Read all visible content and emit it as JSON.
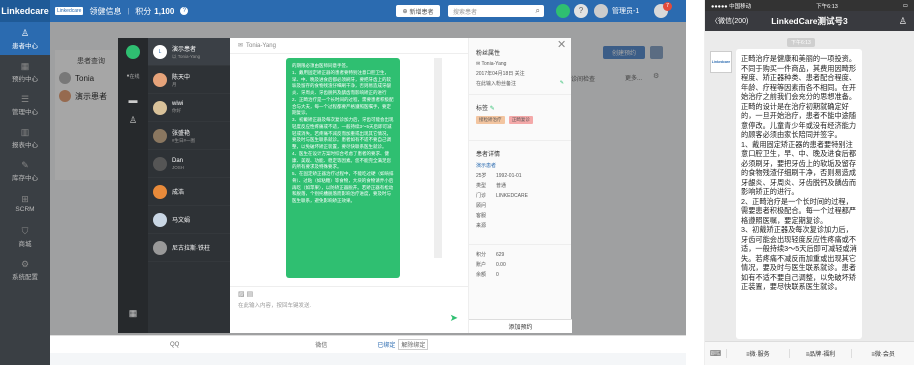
{
  "topbar": {
    "logo": "Linkedcare",
    "mini_logo": "Linkedcare",
    "title": "领健信息",
    "points_label": "积分",
    "points_value": "1,100",
    "new_patient_btn": "新增患者",
    "search_placeholder": "搜索患者",
    "user": "管理员-1",
    "badge": "7"
  },
  "sidebar": {
    "items": [
      {
        "label": "患者中心"
      },
      {
        "label": "预约中心"
      },
      {
        "label": "管理中心"
      },
      {
        "label": "报表中心"
      },
      {
        "label": "库存中心"
      },
      {
        "label": "SCRM"
      },
      {
        "label": "商城"
      },
      {
        "label": "系统配置"
      }
    ]
  },
  "main": {
    "patients_header": "患者查询",
    "patients": [
      {
        "name": "Tonia"
      },
      {
        "name": "演示患者"
      }
    ],
    "create_appt_btn": "创建预约",
    "col_header": "诊间检查",
    "more": "更多...",
    "bottom": {
      "qq": "QQ",
      "wechat": "微信",
      "bound": "已绑定",
      "unbind": "解除绑定"
    }
  },
  "chat": {
    "group_label": "在线",
    "contacts": [
      {
        "name": "演示患者",
        "sub": "以 Tonia-Yang"
      },
      {
        "name": "陈天中",
        "sub": "月"
      },
      {
        "name": "wiwi",
        "sub": "你好"
      },
      {
        "name": "张盛艳",
        "sub": "#生日#一图"
      },
      {
        "name": "Dan",
        "sub": "JOSH"
      },
      {
        "name": "成浩",
        "sub": ""
      },
      {
        "name": "马文娟",
        "sub": ""
      },
      {
        "name": "尼古拉斯·铁柱",
        "sub": ""
      }
    ],
    "header_name": "Tonia-Yang",
    "message": "的期限必须由医师同意手签。\n1、戴用固定矫正器的患者要特别注意口腔卫生，早、中、晚及进食后都必须刷牙，要把牙齿上的软垢及留存的食物残渣仔细刷干净，否则易造成牙龈炎、牙周炎、牙齿脱钙及龋齿而影响矫正的进行\n2、正畸治疗是一个长时间的过程，需要患者积极配合与大夫，每一个过程都要严格遵照医嘱手，要定期复诊。\n3、初戴矫正器及每次复诊加力后，牙齿可能会出现轻度反应性疼痛或不适，一般持续3～5天后即可减轻或消失。若疼痛不减反而加重或出现其它情况，要及时与医生联系就诊。患者如有不适不要自己调整，以免破坏矫正装置，要尽快联系医生就诊。\n4、医生在设计方案时综合考虑了患者的要求、健康、美观、功能、稳定等因素。您不能完全满足您的所有要求及特殊要求。\n5、在固定矫正器治疗过程中，不能吃过硬（如啃排骨）、过粘（如粘糖）等食物，大块的食物请弄小后再吃（如苹果），以防矫正器脱开。若矫正器有松动和脱落，个别托槽脱落而影响治疗进度，要及时与医生联系，避免影响矫正效果。",
    "input_placeholder": "在此输入内容，按回车键发送."
  },
  "info": {
    "props_title": "粉丝属性",
    "fan_name": "Tonia-Yang",
    "follow_date": "2017年04月18日 关注",
    "note_placeholder": "在此输入粉丝备注",
    "tags_title": "标签",
    "tags": [
      {
        "text": "接粒矫治疗",
        "color": "#f3c5a0"
      },
      {
        "text": "正畸复诊",
        "color": "#f4a9a9"
      }
    ],
    "details_title": "患者详情",
    "patient_name": "演示患者",
    "details": [
      {
        "k": "25岁",
        "v": "1992-01-01"
      },
      {
        "k": "类型",
        "v": "普通"
      },
      {
        "k": "门诊",
        "v": "LINKEDCARE"
      },
      {
        "k": "顾问",
        "v": ""
      },
      {
        "k": "客服",
        "v": ""
      },
      {
        "k": "来源",
        "v": ""
      }
    ],
    "stats": [
      {
        "k": "积分",
        "v": "629"
      },
      {
        "k": "账户",
        "v": "0.00"
      },
      {
        "k": "余额",
        "v": "0"
      }
    ],
    "add_appt": "添加预约"
  },
  "phone": {
    "carrier": "●●●●● 中国移动",
    "time": "下午6:13",
    "back": "〈微信(200)",
    "title": "LinkedCare测试号3",
    "msg_time": "下午6:13",
    "message": "正畸治疗是健康和美丽的一项投资。不同于购买一件商品，其费用因畸形程度、矫正器种类、患者配合程度、年龄、疗程等因素而各不相同。在开始治疗之前我们会充分的思想准备。正畸的设计是在治疗初期就确定好的，一旦开始治疗，患者不能中途随意停改。儿童青少年或没有经济能力的顾客必须由家长陪同并签字。\n1、戴用固定矫正器的患者要特别注意口腔卫生，早、中、晚及进食后都必须刷牙，要把牙齿上的软垢及留存的食物残渣仔细刷干净，否则易造成牙龈炎、牙周炎、牙齿脱钙及龋齿而影响矫正的进行。\n2、正畸治疗是一个长时间的过程，需要患者积极配合。每一个过程都严格遵照医嘱，要定期复诊。\n3、初戴矫正器及每次复诊加力后，牙齿可能会出现轻度反应性疼痛或不适，一般持续3～5天后即可减轻或消失。若疼痛不减反而加重或出现其它情况，要及时与医生联系就诊。患者如有不适不要自己调整，以免破坏矫正装置，要尽快联系医生就诊。",
    "menu": [
      "≡微·服务",
      "≡品牌·福利",
      "≡微·会员"
    ]
  }
}
